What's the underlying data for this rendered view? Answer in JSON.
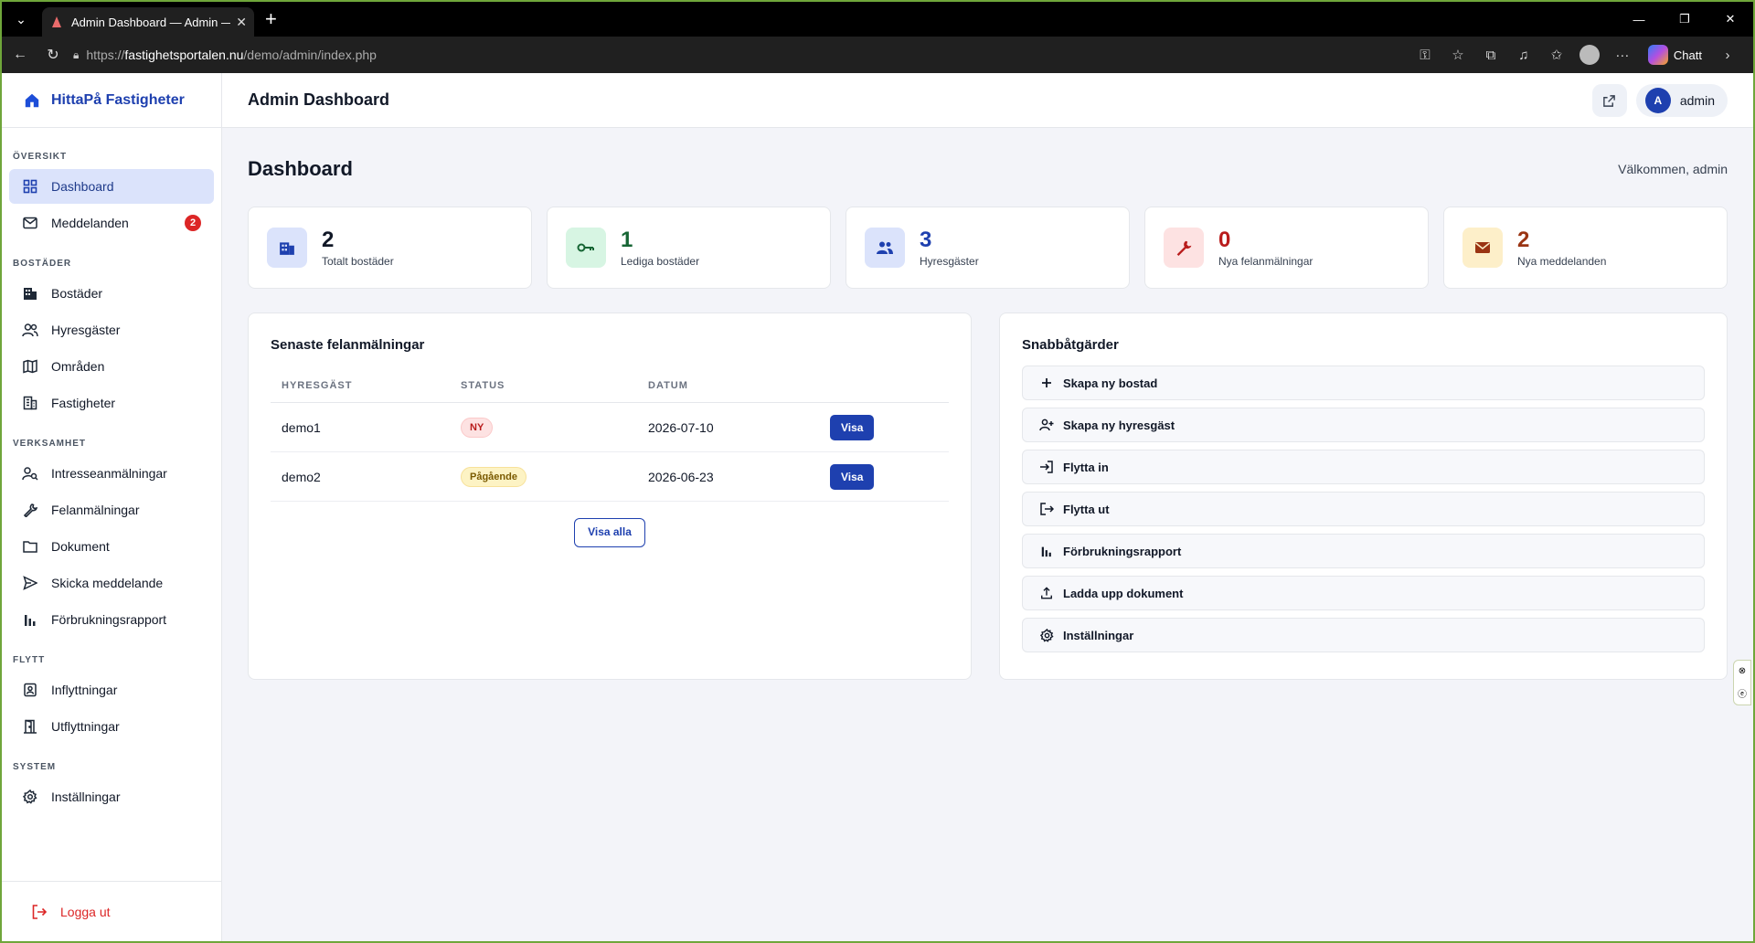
{
  "browser": {
    "tab_title": "Admin Dashboard — Admin — Hi",
    "url_prefix": "https://",
    "url_domain": "fastighetsportalen.nu",
    "url_path": "/demo/admin/index.php",
    "copilot_label": "Chatt"
  },
  "sidebar": {
    "brand": "HittaPå Fastigheter",
    "sections": {
      "oversikt": "ÖVERSIKT",
      "bostader": "BOSTÄDER",
      "verksamhet": "VERKSAMHET",
      "flytt": "FLYTT",
      "system": "SYSTEM"
    },
    "items": {
      "dashboard": "Dashboard",
      "meddelanden": "Meddelanden",
      "meddelanden_badge": "2",
      "bostader": "Bostäder",
      "hyresgaster": "Hyresgäster",
      "omraden": "Områden",
      "fastigheter": "Fastigheter",
      "intresse": "Intresseanmälningar",
      "felanmalningar": "Felanmälningar",
      "dokument": "Dokument",
      "skicka": "Skicka meddelande",
      "forbrukning": "Förbrukningsrapport",
      "inflyttningar": "Inflyttningar",
      "utflyttningar": "Utflyttningar",
      "installningar": "Inställningar"
    },
    "logout": "Logga ut"
  },
  "header": {
    "title": "Admin Dashboard",
    "avatar_letter": "A",
    "user": "admin"
  },
  "page": {
    "title": "Dashboard",
    "welcome": "Välkommen, admin"
  },
  "stats": [
    {
      "value": "2",
      "label": "Totalt bostäder",
      "color": "#1e40af",
      "bg": "#dbe3fb"
    },
    {
      "value": "1",
      "label": "Lediga bostäder",
      "color": "#166534",
      "bg": "#d7f5e3"
    },
    {
      "value": "3",
      "label": "Hyresgäster",
      "color": "#1e40af",
      "bg": "#dbe3fb"
    },
    {
      "value": "0",
      "label": "Nya felanmälningar",
      "color": "#b91c1c",
      "bg": "#fde2e2"
    },
    {
      "value": "2",
      "label": "Nya meddelanden",
      "color": "#9a3412",
      "bg": "#fdefc9"
    }
  ],
  "recent": {
    "title": "Senaste felanmälningar",
    "headers": [
      "HYRESGÄST",
      "STATUS",
      "DATUM",
      ""
    ],
    "rows": [
      {
        "tenant": "demo1",
        "status": "NY",
        "date": "2026-07-10",
        "action": "Visa"
      },
      {
        "tenant": "demo2",
        "status": "Pågående",
        "date": "2026-06-23",
        "action": "Visa"
      }
    ],
    "view_all": "Visa alla"
  },
  "quick": {
    "title": "Snabbåtgärder",
    "items": [
      "Skapa ny bostad",
      "Skapa ny hyresgäst",
      "Flytta in",
      "Flytta ut",
      "Förbrukningsrapport",
      "Ladda upp dokument",
      "Inställningar"
    ]
  }
}
